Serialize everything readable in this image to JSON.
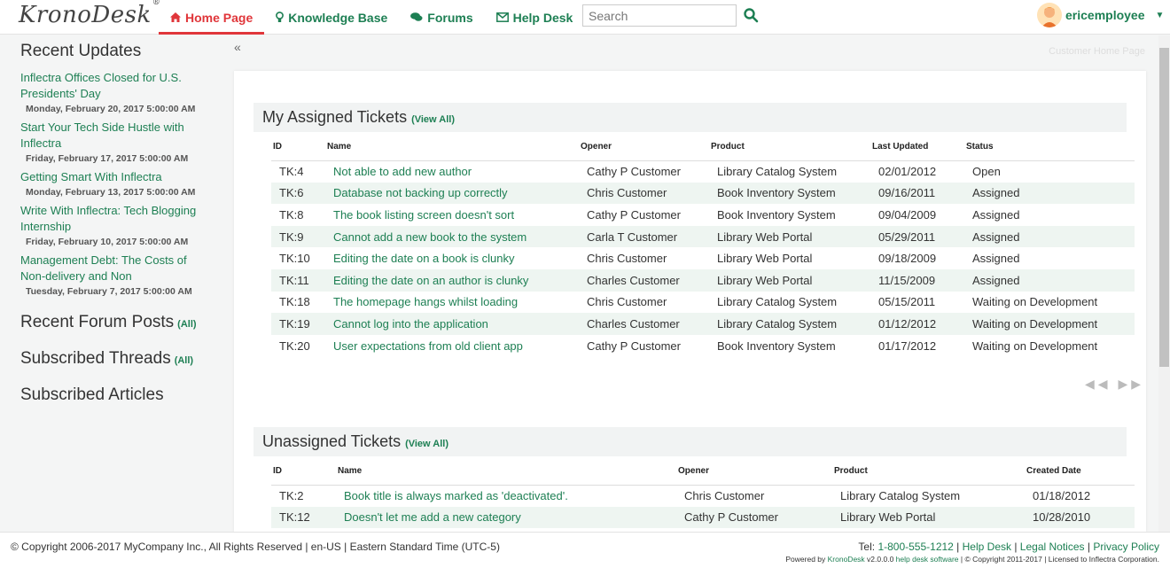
{
  "header": {
    "logo": "KronoDesk",
    "logo_mark": "®",
    "nav": [
      {
        "label": "Home Page",
        "icon": "home-icon",
        "active": true
      },
      {
        "label": "Knowledge Base",
        "icon": "lightbulb-icon"
      },
      {
        "label": "Forums",
        "icon": "comments-icon"
      },
      {
        "label": "Help Desk",
        "icon": "envelope-icon"
      }
    ],
    "search_placeholder": "Search",
    "search_icon": "search-icon",
    "user": "ericemployee",
    "accent": "#1d7f53",
    "active_color": "#e0363a"
  },
  "sidebar": {
    "recent_updates_title": "Recent Updates",
    "updates": [
      {
        "title": "Inflectra Offices Closed for U.S. Presidents' Day",
        "date": "Monday, February 20, 2017 5:00:00 AM"
      },
      {
        "title": "Start Your Tech Side Hustle with Inflectra",
        "date": "Friday, February 17, 2017 5:00:00 AM"
      },
      {
        "title": "Getting Smart With Inflectra",
        "date": "Monday, February 13, 2017 5:00:00 AM"
      },
      {
        "title": "Write With Inflectra: Tech Blogging Internship",
        "date": "Friday, February 10, 2017 5:00:00 AM"
      },
      {
        "title": "Management Debt: The Costs of Non-delivery and Non",
        "date": "Tuesday, February 7, 2017 5:00:00 AM"
      }
    ],
    "forum_posts_title": "Recent Forum Posts",
    "subscribed_threads_title": "Subscribed Threads",
    "all_label": "(All)",
    "subscribed_articles_title": "Subscribed Articles"
  },
  "breadcrumb": "Customer Home Page",
  "assigned": {
    "title": "My Assigned Tickets",
    "view_all": "(View All)",
    "columns": [
      "ID",
      "Name",
      "Opener",
      "Product",
      "Last Updated",
      "Status"
    ],
    "rows": [
      [
        "TK:4",
        "Not able to add new author",
        "Cathy P Customer",
        "Library Catalog System",
        "02/01/2012",
        "Open"
      ],
      [
        "TK:6",
        "Database not backing up correctly",
        "Chris Customer",
        "Book Inventory System",
        "09/16/2011",
        "Assigned"
      ],
      [
        "TK:8",
        "The book listing screen doesn't sort",
        "Cathy P Customer",
        "Book Inventory System",
        "09/04/2009",
        "Assigned"
      ],
      [
        "TK:9",
        "Cannot add a new book to the system",
        "Carla T Customer",
        "Library Web Portal",
        "05/29/2011",
        "Assigned"
      ],
      [
        "TK:10",
        "Editing the date on a book is clunky",
        "Chris Customer",
        "Library Web Portal",
        "09/18/2009",
        "Assigned"
      ],
      [
        "TK:11",
        "Editing the date on an author is clunky",
        "Charles Customer",
        "Library Web Portal",
        "11/15/2009",
        "Assigned"
      ],
      [
        "TK:18",
        "The homepage hangs whilst loading",
        "Chris Customer",
        "Library Catalog System",
        "05/15/2011",
        "Waiting on Development"
      ],
      [
        "TK:19",
        "Cannot log into the application",
        "Charles Customer",
        "Library Catalog System",
        "01/12/2012",
        "Waiting on Development"
      ],
      [
        "TK:20",
        "User expectations from old client app",
        "Cathy P Customer",
        "Book Inventory System",
        "01/17/2012",
        "Waiting on Development"
      ]
    ]
  },
  "unassigned": {
    "title": "Unassigned Tickets",
    "view_all": "(View All)",
    "columns": [
      "ID",
      "Name",
      "Opener",
      "Product",
      "Created Date"
    ],
    "rows": [
      [
        "TK:2",
        "Book title is always marked as 'deactivated'.",
        "Chris Customer",
        "Library Catalog System",
        "01/18/2012"
      ],
      [
        "TK:12",
        "Doesn't let me add a new category",
        "Cathy P Customer",
        "Library Web Portal",
        "10/28/2010"
      ]
    ]
  },
  "footer": {
    "copyright": "© Copyright 2006-2017 MyCompany Inc., All Rights Reserved | en-US | Eastern Standard Time (UTC-5)",
    "tel_label": "Tel: ",
    "tel": "1-800-555-1212",
    "sep": " | ",
    "help_desk": "Help Desk",
    "legal": "Legal Notices",
    "privacy": "Privacy Policy",
    "powered_prefix": "Powered by ",
    "powered_brand": "KronoDesk",
    "powered_version": " v2.0.0.0 ",
    "powered_link": "help desk software",
    "powered_suffix": " | © Copyright 2011-2017 | Licensed to Inflectra Corporation."
  }
}
